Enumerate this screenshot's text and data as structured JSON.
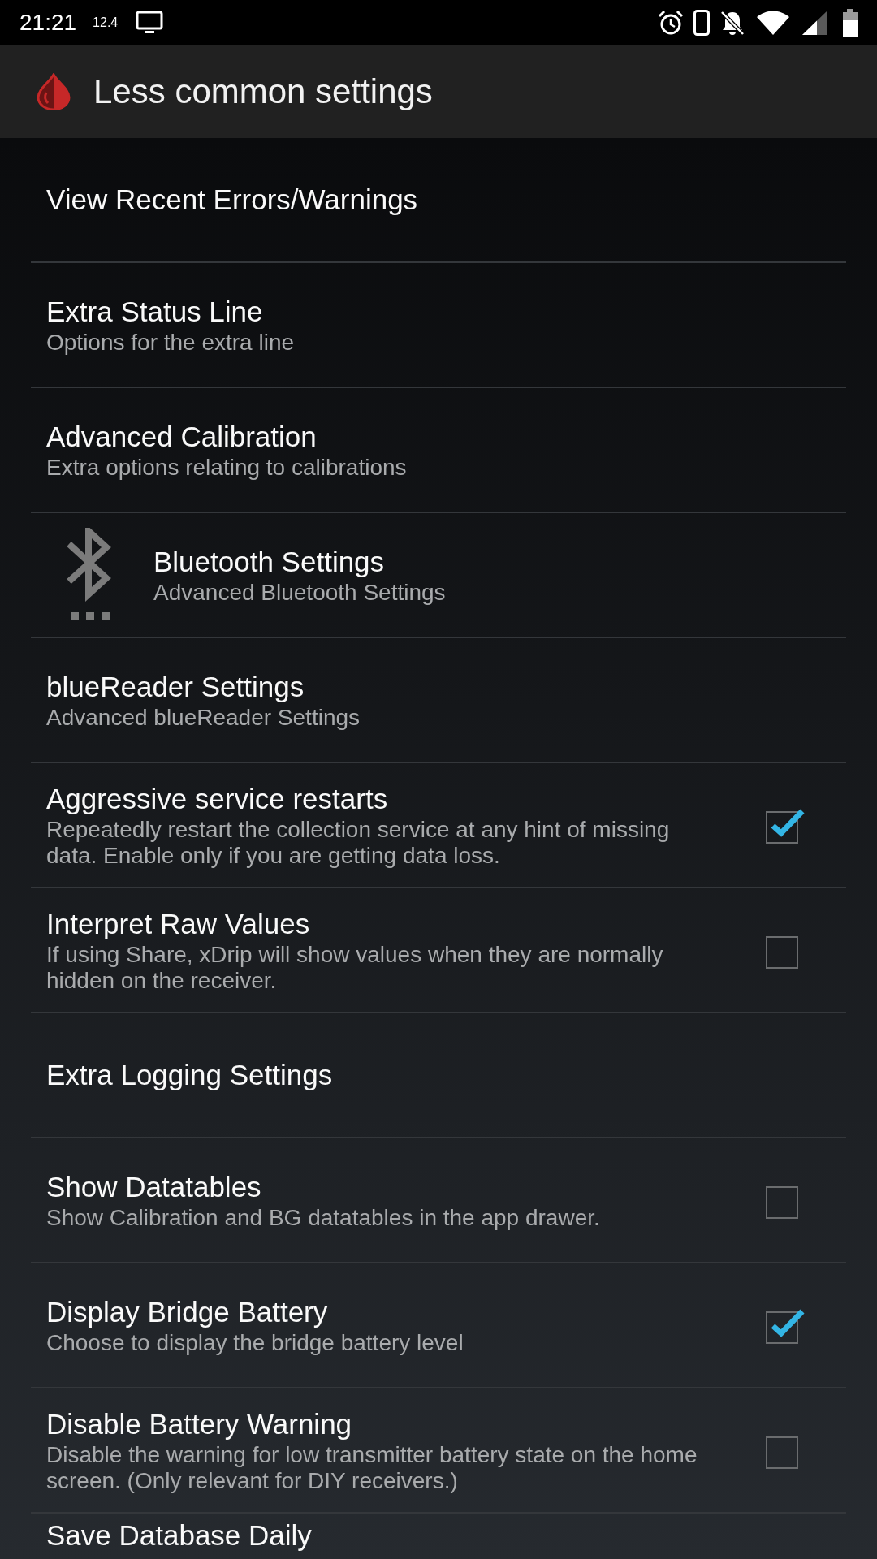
{
  "status_bar": {
    "time": "21:21",
    "net_speed": "12.4"
  },
  "app_bar": {
    "title": "Less common settings"
  },
  "settings": [
    {
      "kind": "plain",
      "title": "View Recent Errors/Warnings"
    },
    {
      "kind": "plain",
      "title": "Extra Status Line",
      "summary": "Options for the extra line"
    },
    {
      "kind": "plain",
      "title": "Advanced Calibration",
      "summary": "Extra options relating to calibrations"
    },
    {
      "kind": "icon",
      "title": "Bluetooth Settings",
      "summary": "Advanced Bluetooth Settings"
    },
    {
      "kind": "plain",
      "title": "blueReader Settings",
      "summary": "Advanced blueReader Settings"
    },
    {
      "kind": "checkbox",
      "title": "Aggressive service restarts",
      "summary": "Repeatedly restart the collection service at any hint of missing data. Enable only if you are getting data loss.",
      "checked": true
    },
    {
      "kind": "checkbox",
      "title": "Interpret Raw Values",
      "summary": "If using Share, xDrip will show values when they are normally hidden on the receiver.",
      "checked": false
    },
    {
      "kind": "plain",
      "title": "Extra Logging Settings"
    },
    {
      "kind": "checkbox",
      "title": "Show Datatables",
      "summary": "Show Calibration and BG datatables in the app drawer.",
      "checked": false
    },
    {
      "kind": "checkbox",
      "title": "Display Bridge Battery",
      "summary": "Choose to display the bridge battery level",
      "checked": true
    },
    {
      "kind": "checkbox",
      "title": "Disable Battery Warning",
      "summary": "Disable the warning for low transmitter battery state on the home screen. (Only relevant for DIY receivers.)",
      "checked": false
    },
    {
      "kind": "plain",
      "title": "Save Database Daily"
    }
  ]
}
